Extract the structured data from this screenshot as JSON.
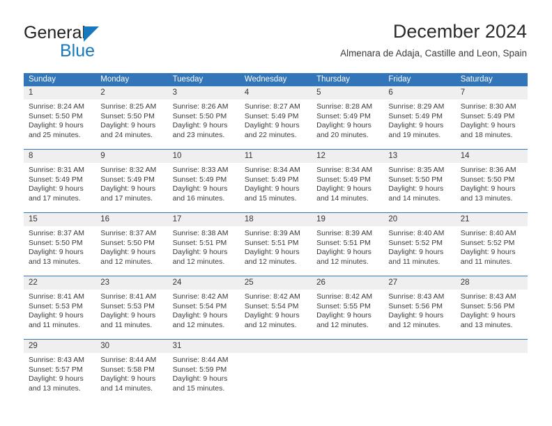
{
  "brand": {
    "name_top": "General",
    "name_bottom": "Blue",
    "accent_color": "#1878be"
  },
  "header": {
    "title": "December 2024",
    "subtitle": "Almenara de Adaja, Castille and Leon, Spain"
  },
  "theme": {
    "header_blue": "#3275b8",
    "daynum_strip": "#efefef",
    "text": "#333333"
  },
  "calendar": {
    "day_headers": [
      "Sunday",
      "Monday",
      "Tuesday",
      "Wednesday",
      "Thursday",
      "Friday",
      "Saturday"
    ],
    "weeks": [
      {
        "days": [
          {
            "num": "1",
            "sunrise": "Sunrise: 8:24 AM",
            "sunset": "Sunset: 5:50 PM",
            "daylight_1": "Daylight: 9 hours",
            "daylight_2": "and 25 minutes."
          },
          {
            "num": "2",
            "sunrise": "Sunrise: 8:25 AM",
            "sunset": "Sunset: 5:50 PM",
            "daylight_1": "Daylight: 9 hours",
            "daylight_2": "and 24 minutes."
          },
          {
            "num": "3",
            "sunrise": "Sunrise: 8:26 AM",
            "sunset": "Sunset: 5:50 PM",
            "daylight_1": "Daylight: 9 hours",
            "daylight_2": "and 23 minutes."
          },
          {
            "num": "4",
            "sunrise": "Sunrise: 8:27 AM",
            "sunset": "Sunset: 5:49 PM",
            "daylight_1": "Daylight: 9 hours",
            "daylight_2": "and 22 minutes."
          },
          {
            "num": "5",
            "sunrise": "Sunrise: 8:28 AM",
            "sunset": "Sunset: 5:49 PM",
            "daylight_1": "Daylight: 9 hours",
            "daylight_2": "and 20 minutes."
          },
          {
            "num": "6",
            "sunrise": "Sunrise: 8:29 AM",
            "sunset": "Sunset: 5:49 PM",
            "daylight_1": "Daylight: 9 hours",
            "daylight_2": "and 19 minutes."
          },
          {
            "num": "7",
            "sunrise": "Sunrise: 8:30 AM",
            "sunset": "Sunset: 5:49 PM",
            "daylight_1": "Daylight: 9 hours",
            "daylight_2": "and 18 minutes."
          }
        ]
      },
      {
        "days": [
          {
            "num": "8",
            "sunrise": "Sunrise: 8:31 AM",
            "sunset": "Sunset: 5:49 PM",
            "daylight_1": "Daylight: 9 hours",
            "daylight_2": "and 17 minutes."
          },
          {
            "num": "9",
            "sunrise": "Sunrise: 8:32 AM",
            "sunset": "Sunset: 5:49 PM",
            "daylight_1": "Daylight: 9 hours",
            "daylight_2": "and 17 minutes."
          },
          {
            "num": "10",
            "sunrise": "Sunrise: 8:33 AM",
            "sunset": "Sunset: 5:49 PM",
            "daylight_1": "Daylight: 9 hours",
            "daylight_2": "and 16 minutes."
          },
          {
            "num": "11",
            "sunrise": "Sunrise: 8:34 AM",
            "sunset": "Sunset: 5:49 PM",
            "daylight_1": "Daylight: 9 hours",
            "daylight_2": "and 15 minutes."
          },
          {
            "num": "12",
            "sunrise": "Sunrise: 8:34 AM",
            "sunset": "Sunset: 5:49 PM",
            "daylight_1": "Daylight: 9 hours",
            "daylight_2": "and 14 minutes."
          },
          {
            "num": "13",
            "sunrise": "Sunrise: 8:35 AM",
            "sunset": "Sunset: 5:50 PM",
            "daylight_1": "Daylight: 9 hours",
            "daylight_2": "and 14 minutes."
          },
          {
            "num": "14",
            "sunrise": "Sunrise: 8:36 AM",
            "sunset": "Sunset: 5:50 PM",
            "daylight_1": "Daylight: 9 hours",
            "daylight_2": "and 13 minutes."
          }
        ]
      },
      {
        "days": [
          {
            "num": "15",
            "sunrise": "Sunrise: 8:37 AM",
            "sunset": "Sunset: 5:50 PM",
            "daylight_1": "Daylight: 9 hours",
            "daylight_2": "and 13 minutes."
          },
          {
            "num": "16",
            "sunrise": "Sunrise: 8:37 AM",
            "sunset": "Sunset: 5:50 PM",
            "daylight_1": "Daylight: 9 hours",
            "daylight_2": "and 12 minutes."
          },
          {
            "num": "17",
            "sunrise": "Sunrise: 8:38 AM",
            "sunset": "Sunset: 5:51 PM",
            "daylight_1": "Daylight: 9 hours",
            "daylight_2": "and 12 minutes."
          },
          {
            "num": "18",
            "sunrise": "Sunrise: 8:39 AM",
            "sunset": "Sunset: 5:51 PM",
            "daylight_1": "Daylight: 9 hours",
            "daylight_2": "and 12 minutes."
          },
          {
            "num": "19",
            "sunrise": "Sunrise: 8:39 AM",
            "sunset": "Sunset: 5:51 PM",
            "daylight_1": "Daylight: 9 hours",
            "daylight_2": "and 12 minutes."
          },
          {
            "num": "20",
            "sunrise": "Sunrise: 8:40 AM",
            "sunset": "Sunset: 5:52 PM",
            "daylight_1": "Daylight: 9 hours",
            "daylight_2": "and 11 minutes."
          },
          {
            "num": "21",
            "sunrise": "Sunrise: 8:40 AM",
            "sunset": "Sunset: 5:52 PM",
            "daylight_1": "Daylight: 9 hours",
            "daylight_2": "and 11 minutes."
          }
        ]
      },
      {
        "days": [
          {
            "num": "22",
            "sunrise": "Sunrise: 8:41 AM",
            "sunset": "Sunset: 5:53 PM",
            "daylight_1": "Daylight: 9 hours",
            "daylight_2": "and 11 minutes."
          },
          {
            "num": "23",
            "sunrise": "Sunrise: 8:41 AM",
            "sunset": "Sunset: 5:53 PM",
            "daylight_1": "Daylight: 9 hours",
            "daylight_2": "and 11 minutes."
          },
          {
            "num": "24",
            "sunrise": "Sunrise: 8:42 AM",
            "sunset": "Sunset: 5:54 PM",
            "daylight_1": "Daylight: 9 hours",
            "daylight_2": "and 12 minutes."
          },
          {
            "num": "25",
            "sunrise": "Sunrise: 8:42 AM",
            "sunset": "Sunset: 5:54 PM",
            "daylight_1": "Daylight: 9 hours",
            "daylight_2": "and 12 minutes."
          },
          {
            "num": "26",
            "sunrise": "Sunrise: 8:42 AM",
            "sunset": "Sunset: 5:55 PM",
            "daylight_1": "Daylight: 9 hours",
            "daylight_2": "and 12 minutes."
          },
          {
            "num": "27",
            "sunrise": "Sunrise: 8:43 AM",
            "sunset": "Sunset: 5:56 PM",
            "daylight_1": "Daylight: 9 hours",
            "daylight_2": "and 12 minutes."
          },
          {
            "num": "28",
            "sunrise": "Sunrise: 8:43 AM",
            "sunset": "Sunset: 5:56 PM",
            "daylight_1": "Daylight: 9 hours",
            "daylight_2": "and 13 minutes."
          }
        ]
      },
      {
        "days": [
          {
            "num": "29",
            "sunrise": "Sunrise: 8:43 AM",
            "sunset": "Sunset: 5:57 PM",
            "daylight_1": "Daylight: 9 hours",
            "daylight_2": "and 13 minutes."
          },
          {
            "num": "30",
            "sunrise": "Sunrise: 8:44 AM",
            "sunset": "Sunset: 5:58 PM",
            "daylight_1": "Daylight: 9 hours",
            "daylight_2": "and 14 minutes."
          },
          {
            "num": "31",
            "sunrise": "Sunrise: 8:44 AM",
            "sunset": "Sunset: 5:59 PM",
            "daylight_1": "Daylight: 9 hours",
            "daylight_2": "and 15 minutes."
          },
          {
            "num": "",
            "sunrise": "",
            "sunset": "",
            "daylight_1": "",
            "daylight_2": ""
          },
          {
            "num": "",
            "sunrise": "",
            "sunset": "",
            "daylight_1": "",
            "daylight_2": ""
          },
          {
            "num": "",
            "sunrise": "",
            "sunset": "",
            "daylight_1": "",
            "daylight_2": ""
          },
          {
            "num": "",
            "sunrise": "",
            "sunset": "",
            "daylight_1": "",
            "daylight_2": ""
          }
        ]
      }
    ]
  }
}
